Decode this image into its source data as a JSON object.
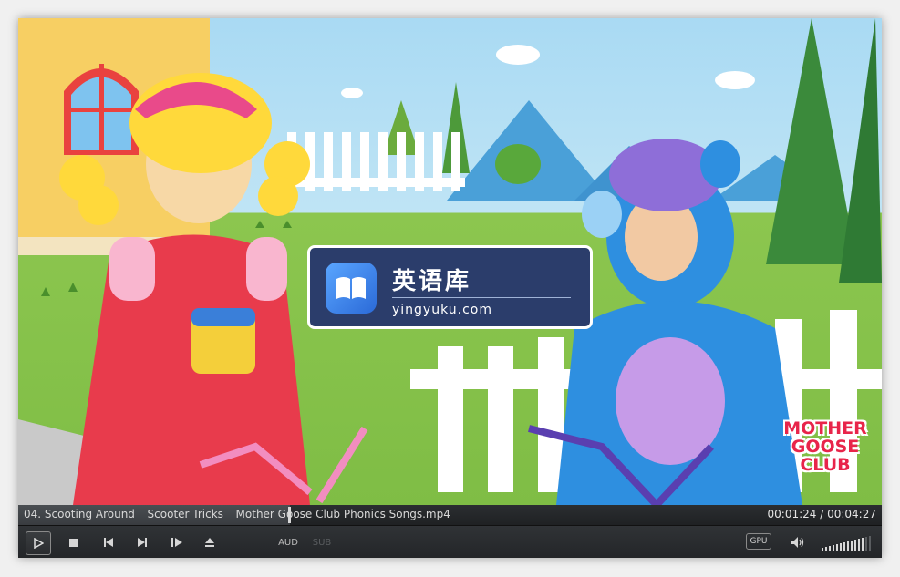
{
  "player": {
    "file_title": "04. Scooting Around _ Scooter Tricks _ Mother Goose Club Phonics Songs.mp4",
    "time_display": "00:01:24 / 00:04:27",
    "progress": 0.315,
    "volume_level": 0.85
  },
  "watermark": {
    "title": "英语库",
    "url": "yingyuku.com"
  },
  "video_brand": {
    "line1": "MOTHER",
    "line2": "GOOSE",
    "line3": "CLUB"
  },
  "controls": {
    "aud_label": "AUD",
    "sub_label": "SUB",
    "gpu_label": "GPU",
    "icons": [
      "play-icon",
      "stop-icon",
      "previous-icon",
      "next-icon",
      "frame-step-icon",
      "eject-icon",
      "speaker-icon",
      "volume-bars-icon"
    ]
  },
  "colors": {
    "accent_text": "#d8d8d8",
    "watermark_bg": "#2b3d6b",
    "brand_red": "#e8254a"
  }
}
